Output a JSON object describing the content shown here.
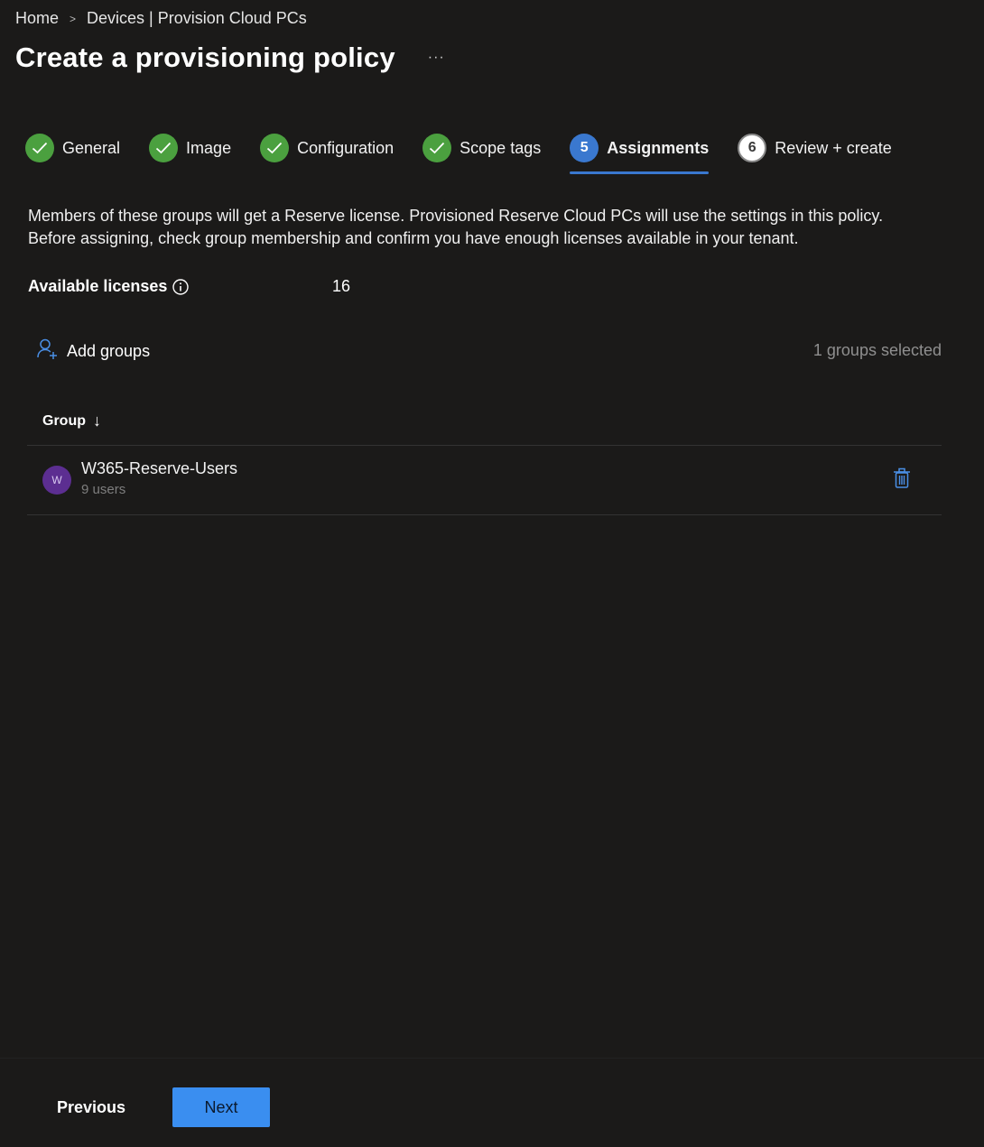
{
  "breadcrumb": {
    "items": [
      "Home",
      "Devices | Provision Cloud PCs"
    ]
  },
  "page": {
    "title": "Create a provisioning policy",
    "more": "···"
  },
  "wizard": {
    "steps": [
      {
        "label": "General",
        "status": "done"
      },
      {
        "label": "Image",
        "status": "done"
      },
      {
        "label": "Configuration",
        "status": "done"
      },
      {
        "label": "Scope tags",
        "status": "done"
      },
      {
        "label": "Assignments",
        "number": "5",
        "status": "current"
      },
      {
        "label": "Review + create",
        "number": "6",
        "status": "pending"
      }
    ]
  },
  "description": {
    "line1": "Members of these groups will get a Reserve license. Provisioned Reserve Cloud PCs will use the settings in this policy.",
    "line2": "Before assigning, check group membership and confirm you have enough licenses available in your tenant."
  },
  "licenses": {
    "label": "Available licenses",
    "value": "16"
  },
  "toolbar": {
    "add_groups_label": "Add groups",
    "selected_count": "1 groups selected"
  },
  "table": {
    "header": "Group",
    "sort_icon": "↓",
    "rows": [
      {
        "initial": "W",
        "name": "W365-Reserve-Users",
        "sub": "9 users"
      }
    ]
  },
  "footer": {
    "previous_label": "Previous",
    "next_label": "Next"
  },
  "colors": {
    "background": "#1b1a19",
    "accent": "#3a78cf",
    "success": "#4ba03f",
    "avatar": "#5c2e91"
  }
}
